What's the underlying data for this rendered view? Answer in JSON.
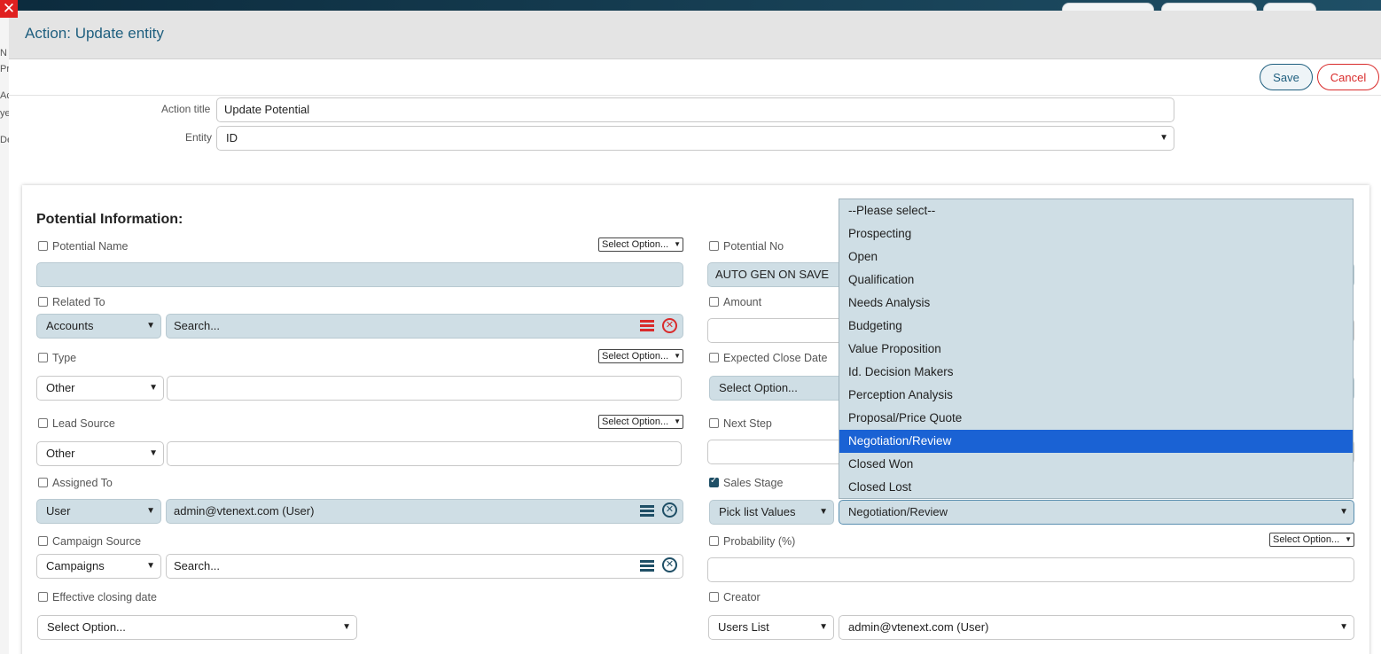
{
  "modal": {
    "title": "Action: Update entity",
    "save_label": "Save",
    "cancel_label": "Cancel"
  },
  "header_form": {
    "action_title_label": "Action title",
    "action_title_value": "Update Potential",
    "entity_label": "Entity",
    "entity_value": "ID"
  },
  "section": {
    "title": "Potential Information:",
    "select_option_label": "Select Option...",
    "fields": {
      "potential_name": {
        "label": "Potential Name"
      },
      "potential_no": {
        "label": "Potential No",
        "value": "AUTO GEN ON SAVE"
      },
      "related_to": {
        "label": "Related To",
        "type_value": "Accounts",
        "search_placeholder": "Search..."
      },
      "amount": {
        "label": "Amount"
      },
      "type": {
        "label": "Type",
        "value": "Other"
      },
      "expected_close_date": {
        "label": "Expected Close Date",
        "value": "Select Option..."
      },
      "lead_source": {
        "label": "Lead Source",
        "value": "Other"
      },
      "next_step": {
        "label": "Next Step"
      },
      "assigned_to": {
        "label": "Assigned To",
        "type_value": "User",
        "value": "admin@vtenext.com (User)"
      },
      "sales_stage": {
        "label": "Sales Stage",
        "source_value": "Pick list Values",
        "value": "Negotiation/Review"
      },
      "campaign_source": {
        "label": "Campaign Source",
        "type_value": "Campaigns",
        "search_placeholder": "Search..."
      },
      "probability": {
        "label": "Probability (%)"
      },
      "effective_closing_date": {
        "label": "Effective closing date",
        "value": "Select Option..."
      },
      "creator": {
        "label": "Creator",
        "source_value": "Users List",
        "value": "admin@vtenext.com (User)"
      }
    }
  },
  "dropdown": {
    "options": [
      "--Please select--",
      "Prospecting",
      "Open",
      "Qualification",
      "Needs Analysis",
      "Budgeting",
      "Value Proposition",
      "Id. Decision Makers",
      "Perception Analysis",
      "Proposal/Price Quote",
      "Negotiation/Review",
      "Closed Won",
      "Closed Lost"
    ],
    "selected_index": 10
  },
  "background": {
    "left_letters": [
      "N",
      "Pr",
      "Ac",
      "ye",
      "De"
    ]
  },
  "colors": {
    "accent": "#1f5f7f",
    "danger": "#d92b2b",
    "field_bg": "#cfdee5",
    "selected": "#1a62d4"
  }
}
